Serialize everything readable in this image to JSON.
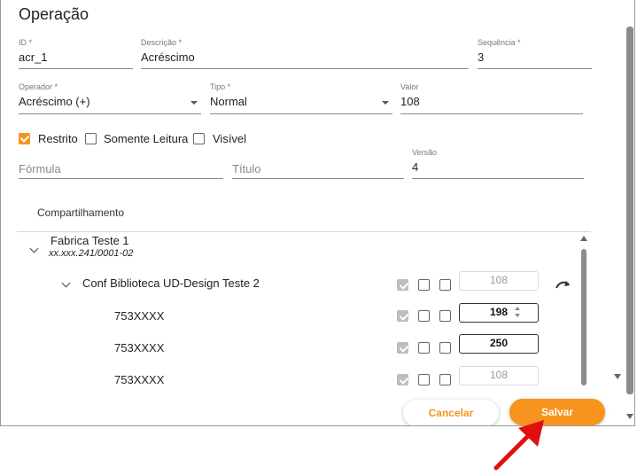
{
  "dialog": {
    "title": "Operação"
  },
  "form": {
    "id": {
      "label": "ID *",
      "value": "acr_1"
    },
    "descricao": {
      "label": "Descrição *",
      "value": "Acréscimo"
    },
    "sequencia": {
      "label": "Sequência *",
      "value": "3"
    },
    "operador": {
      "label": "Operador *",
      "value": "Acréscimo (+)"
    },
    "tipo": {
      "label": "Tipo *",
      "value": "Normal"
    },
    "valor": {
      "label": "Valor",
      "value": "108"
    },
    "checkboxes": {
      "restrito": {
        "label": "Restrito",
        "checked": true
      },
      "somente_leitura": {
        "label": "Somente Leitura",
        "checked": false
      },
      "visivel": {
        "label": "Visível",
        "checked": false
      }
    },
    "formula": {
      "placeholder": "Fórmula"
    },
    "titulo": {
      "placeholder": "Título"
    },
    "versao": {
      "label": "Versão",
      "value": "4"
    }
  },
  "tabs": [
    {
      "label": "Compartilhamento",
      "active": true
    }
  ],
  "tree": {
    "root": {
      "name": "Fabrica Teste 1",
      "subtitle": "xx.xxx.241/0001-02"
    },
    "group": {
      "name": "Conf Biblioteca UD-Design Teste 2",
      "value": "108"
    },
    "items": [
      {
        "name": "753XXXX",
        "value": "198",
        "editing": true
      },
      {
        "name": "753XXXX",
        "value": "250",
        "editing": false
      },
      {
        "name": "753XXXX",
        "value": "108",
        "editing": false
      }
    ]
  },
  "icons": {
    "reset": "redo-arrow-icon",
    "expand": "chevron-down-icon"
  },
  "colors": {
    "accent": "#f7931e",
    "annotation": "#e01010"
  },
  "footer": {
    "cancel_label": "Cancelar",
    "save_label": "Salvar"
  }
}
